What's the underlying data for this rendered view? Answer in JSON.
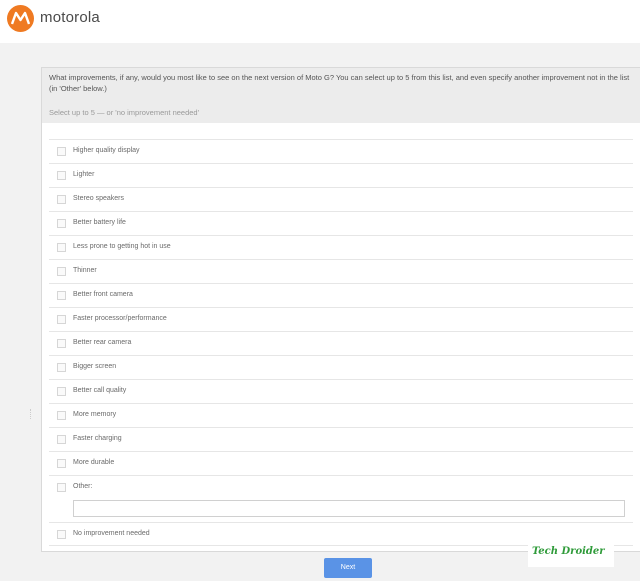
{
  "header": {
    "brand_name": "motorola",
    "logo_icon": "motorola-batwing-icon",
    "brand_color": "#ef7a22"
  },
  "survey": {
    "question": "What improvements, if any, would you most like to see on the next version of Moto G? You can select up to 5 from this list, and even specify another improvement not in the list (in 'Other' below.)",
    "hint": "Select up to 5 — or 'no improvement needed'",
    "options": [
      {
        "label": "Higher quality display",
        "checked": false
      },
      {
        "label": "Lighter",
        "checked": false
      },
      {
        "label": "Stereo speakers",
        "checked": false
      },
      {
        "label": "Better battery life",
        "checked": false
      },
      {
        "label": "Less prone to getting hot in use",
        "checked": false
      },
      {
        "label": "Thinner",
        "checked": false
      },
      {
        "label": "Better front camera",
        "checked": false
      },
      {
        "label": "Faster processor/performance",
        "checked": false
      },
      {
        "label": "Better rear camera",
        "checked": false
      },
      {
        "label": "Bigger screen",
        "checked": false
      },
      {
        "label": "Better call quality",
        "checked": false
      },
      {
        "label": "More memory",
        "checked": false
      },
      {
        "label": "Faster charging",
        "checked": false
      },
      {
        "label": "More durable",
        "checked": false
      }
    ],
    "other_label": "Other:",
    "other_value": "",
    "none_label": "No improvement needed",
    "next_label": "Next",
    "button_color": "#5a93e6"
  },
  "watermark": {
    "text": "Tech Droider"
  }
}
